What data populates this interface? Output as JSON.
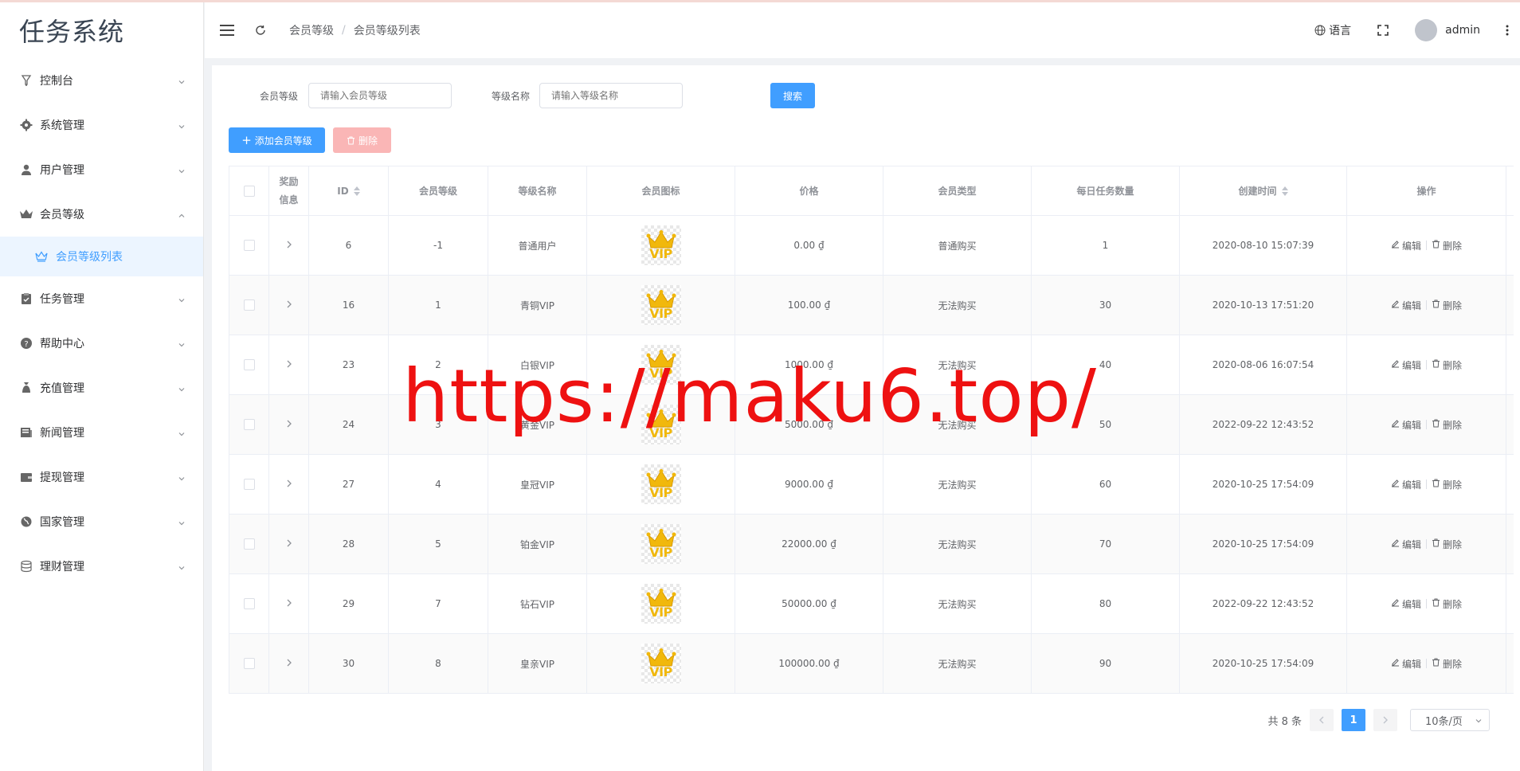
{
  "app": {
    "title": "任务系统"
  },
  "sidebar": {
    "items": [
      {
        "label": "控制台",
        "icon": "dashboard-icon"
      },
      {
        "label": "系统管理",
        "icon": "gear-icon"
      },
      {
        "label": "用户管理",
        "icon": "user-icon"
      },
      {
        "label": "会员等级",
        "icon": "crown-icon",
        "expanded": true
      },
      {
        "label": "任务管理",
        "icon": "clipboard-icon"
      },
      {
        "label": "帮助中心",
        "icon": "help-icon"
      },
      {
        "label": "充值管理",
        "icon": "money-bag-icon"
      },
      {
        "label": "新闻管理",
        "icon": "news-icon"
      },
      {
        "label": "提现管理",
        "icon": "wallet-icon"
      },
      {
        "label": "国家管理",
        "icon": "globe-icon"
      },
      {
        "label": "理财管理",
        "icon": "database-icon"
      }
    ],
    "subitem": {
      "label": "会员等级列表",
      "icon": "crown-outline-icon"
    }
  },
  "header": {
    "breadcrumb": [
      "会员等级",
      "会员等级列表"
    ],
    "language": "语言",
    "username": "admin"
  },
  "filters": {
    "level_label": "会员等级",
    "level_placeholder": "请输入会员等级",
    "name_label": "等级名称",
    "name_placeholder": "请输入等级名称",
    "search_label": "搜索"
  },
  "toolbar": {
    "add_label": "添加会员等级",
    "delete_label": "删除"
  },
  "table": {
    "headers": {
      "reward_line1": "奖励",
      "reward_line2": "信息",
      "id": "ID",
      "level": "会员等级",
      "name": "等级名称",
      "icon": "会员图标",
      "price": "价格",
      "type": "会员类型",
      "daily": "每日任务数量",
      "created": "创建时间",
      "ops": "操作"
    },
    "icon_text": "VIP",
    "edit_label": "编辑",
    "delete_label": "删除",
    "rows": [
      {
        "id": "6",
        "level": "-1",
        "name": "普通用户",
        "price": "0.00 ₫",
        "type": "普通购买",
        "daily": "1",
        "created": "2020-08-10 15:07:39"
      },
      {
        "id": "16",
        "level": "1",
        "name": "青铜VIP",
        "price": "100.00 ₫",
        "type": "无法购买",
        "daily": "30",
        "created": "2020-10-13 17:51:20"
      },
      {
        "id": "23",
        "level": "2",
        "name": "白银VIP",
        "price": "1000.00 ₫",
        "type": "无法购买",
        "daily": "40",
        "created": "2020-08-06 16:07:54"
      },
      {
        "id": "24",
        "level": "3",
        "name": "黄金VIP",
        "price": "5000.00 ₫",
        "type": "无法购买",
        "daily": "50",
        "created": "2022-09-22 12:43:52"
      },
      {
        "id": "27",
        "level": "4",
        "name": "皇冠VIP",
        "price": "9000.00 ₫",
        "type": "无法购买",
        "daily": "60",
        "created": "2020-10-25 17:54:09"
      },
      {
        "id": "28",
        "level": "5",
        "name": "铂金VIP",
        "price": "22000.00 ₫",
        "type": "无法购买",
        "daily": "70",
        "created": "2020-10-25 17:54:09"
      },
      {
        "id": "29",
        "level": "7",
        "name": "钻石VIP",
        "price": "50000.00 ₫",
        "type": "无法购买",
        "daily": "80",
        "created": "2022-09-22 12:43:52"
      },
      {
        "id": "30",
        "level": "8",
        "name": "皇亲VIP",
        "price": "100000.00 ₫",
        "type": "无法购买",
        "daily": "90",
        "created": "2020-10-25 17:54:09"
      }
    ]
  },
  "pagination": {
    "total_text": "共 8 条",
    "current_page": "1",
    "page_size": "10条/页"
  },
  "watermark": "https://maku6.top/",
  "colors": {
    "primary": "#409eff",
    "danger_light": "#fab6b6",
    "watermark": "#ee1111",
    "vip_gold": "#f1b80c"
  }
}
